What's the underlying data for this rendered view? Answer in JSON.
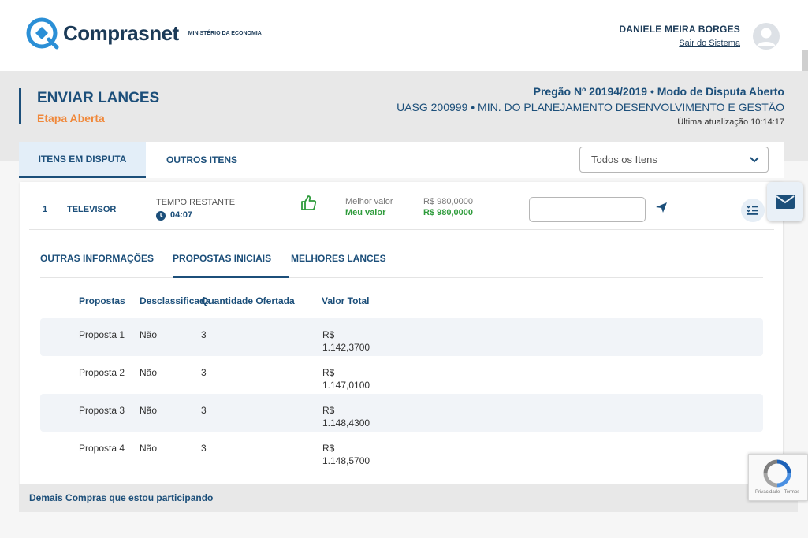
{
  "header": {
    "logo_text": "Comprasnet",
    "logo_subtitle": "MINISTÉRIO DA ECONOMIA",
    "user_name": "DANIELE MEIRA BORGES",
    "logout_label": "Sair do Sistema"
  },
  "page": {
    "title": "ENVIAR LANCES",
    "subtitle": "Etapa Aberta",
    "pregao": "Pregão Nº 20194/2019  •  Modo de Disputa Aberto",
    "uasg": "UASG 200999  •  MIN. DO PLANEJAMENTO DESENVOLVIMENTO E GESTÃO",
    "last_update": "Última atualização 10:14:17"
  },
  "tabs": [
    {
      "label": "ITENS EM DISPUTA",
      "active": true
    },
    {
      "label": "OUTROS ITENS",
      "active": false
    }
  ],
  "filter": {
    "selected": "Todos os Itens"
  },
  "item": {
    "number": "1",
    "name": "TELEVISOR",
    "time_label": "TEMPO RESTANTE",
    "time_value": "04:07",
    "best_label": "Melhor valor",
    "best_value": "R$ 980,0000",
    "my_label": "Meu valor",
    "my_value": "R$ 980,0000",
    "bid_value": ""
  },
  "sub_tabs": [
    {
      "label": "OUTRAS INFORMAÇÕES",
      "active": false
    },
    {
      "label": "PROPOSTAS INICIAIS",
      "active": true
    },
    {
      "label": "MELHORES LANCES",
      "active": false
    }
  ],
  "table": {
    "headers": [
      "Propostas",
      "Desclassificada",
      "Quantidade Ofertada",
      "Valor Total"
    ],
    "rows": [
      {
        "proposta": "Proposta 1",
        "desclassificada": "Não",
        "quantidade": "3",
        "valor_line1": "R$",
        "valor_line2": "1.142,3700"
      },
      {
        "proposta": "Proposta 2",
        "desclassificada": "Não",
        "quantidade": "3",
        "valor_line1": "R$",
        "valor_line2": "1.147,0100"
      },
      {
        "proposta": "Proposta 3",
        "desclassificada": "Não",
        "quantidade": "3",
        "valor_line1": "R$",
        "valor_line2": "1.148,4300"
      },
      {
        "proposta": "Proposta 4",
        "desclassificada": "Não",
        "quantidade": "3",
        "valor_line1": "R$",
        "valor_line2": "1.148,5700"
      }
    ]
  },
  "footer": {
    "label": "Demais Compras que estou participando"
  },
  "recaptcha": {
    "text": "Privacidade - Termos"
  },
  "colors": {
    "primary": "#1c4f7a",
    "accent": "#f0883a",
    "success": "#2e9b3b"
  }
}
